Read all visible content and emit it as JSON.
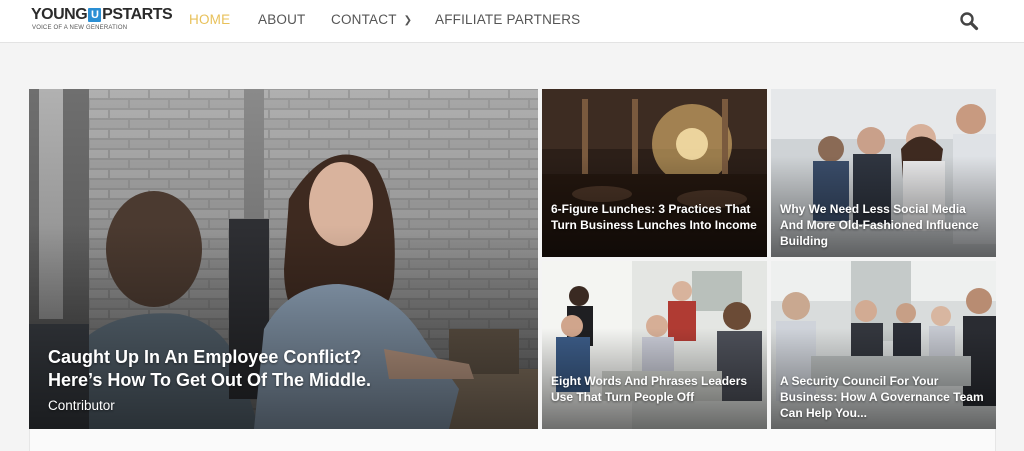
{
  "site": {
    "logo_left": "YOUNG",
    "logo_mark": "U",
    "logo_right": "PSTARTS",
    "tagline": "VOICE OF A NEW GENERATION"
  },
  "nav": {
    "home": "HOME",
    "about": "ABOUT",
    "contact": "CONTACT",
    "affiliate": "AFFILIATE PARTNERS"
  },
  "colors": {
    "active_nav": "#e8c15a",
    "logo_accent": "#2a8fd4"
  },
  "featured": {
    "title_line1": "Caught Up In An Employee Conflict?",
    "title_line2": "Here’s How To Get Out Of The Middle.",
    "author": "Contributor"
  },
  "posts": [
    {
      "title": "6-Figure Lunches: 3 Practices That Turn Business Lunches Into Income"
    },
    {
      "title": "Why We Need Less Social Media And More Old-Fashioned Influence Building"
    },
    {
      "title": "Eight Words And Phrases Leaders Use That Turn People Off"
    },
    {
      "title": "A Security Council For Your Business: How A Governance Team Can Help You..."
    }
  ],
  "icons": {
    "search": "search-icon",
    "contact_dropdown": "chevron-down-icon"
  }
}
